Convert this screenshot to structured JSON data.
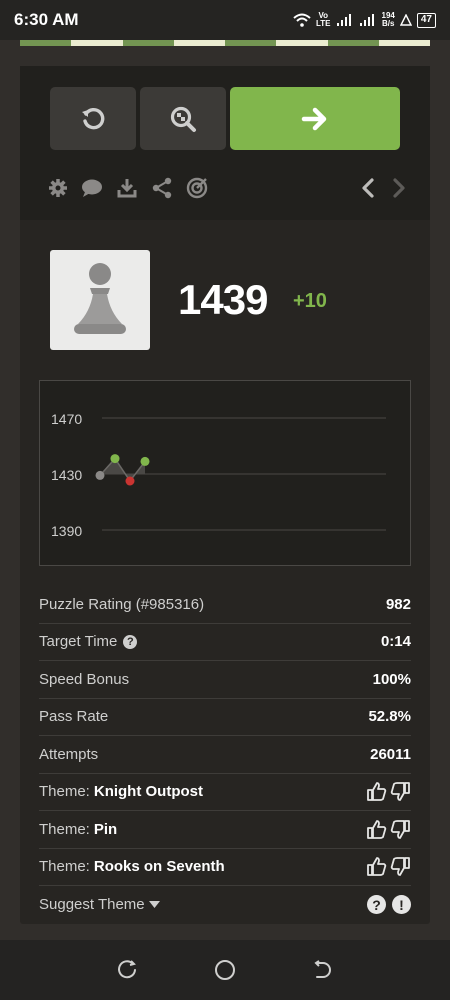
{
  "status_bar": {
    "time": "6:30 AM",
    "network_top": "Vo",
    "network_bottom": "LTE",
    "speed_top": "194",
    "speed_bottom": "B/s",
    "battery": "47"
  },
  "controls": {
    "retry_icon": "retry-icon",
    "analyze_icon": "analysis-icon",
    "next_icon": "arrow-right-icon",
    "tools": [
      "gear-icon",
      "chat-icon",
      "download-icon",
      "share-icon",
      "target-icon"
    ],
    "prev_icon": "chevron-left-icon",
    "next_nav_icon": "chevron-right-icon"
  },
  "rating": {
    "value": "1439",
    "delta": "+10"
  },
  "chart_data": {
    "type": "line",
    "ylim": [
      1390,
      1470
    ],
    "yticks": [
      "1470",
      "1430",
      "1390"
    ],
    "x": [
      1,
      2,
      3,
      4
    ],
    "series": [
      {
        "values": [
          1429,
          1441,
          1425,
          1439
        ],
        "point_colors": [
          "#8b8987",
          "#81b64c",
          "#ca3431",
          "#81b64c"
        ]
      }
    ]
  },
  "stats": [
    {
      "label": "Puzzle Rating (#985316)",
      "value": "982"
    },
    {
      "label": "Target Time",
      "value": "0:14",
      "help": "?"
    },
    {
      "label": "Speed Bonus",
      "value": "100%"
    },
    {
      "label": "Pass Rate",
      "value": "52.8%"
    },
    {
      "label": "Attempts",
      "value": "26011"
    }
  ],
  "themes": [
    {
      "prefix": "Theme:",
      "name": "Knight Outpost"
    },
    {
      "prefix": "Theme:",
      "name": "Pin"
    },
    {
      "prefix": "Theme:",
      "name": "Rooks on Seventh"
    }
  ],
  "suggest": {
    "label": "Suggest Theme",
    "help": "?",
    "report": "!"
  },
  "colors": {
    "accent": "#81b64c",
    "panel": "#272522",
    "background": "#312e2b"
  }
}
